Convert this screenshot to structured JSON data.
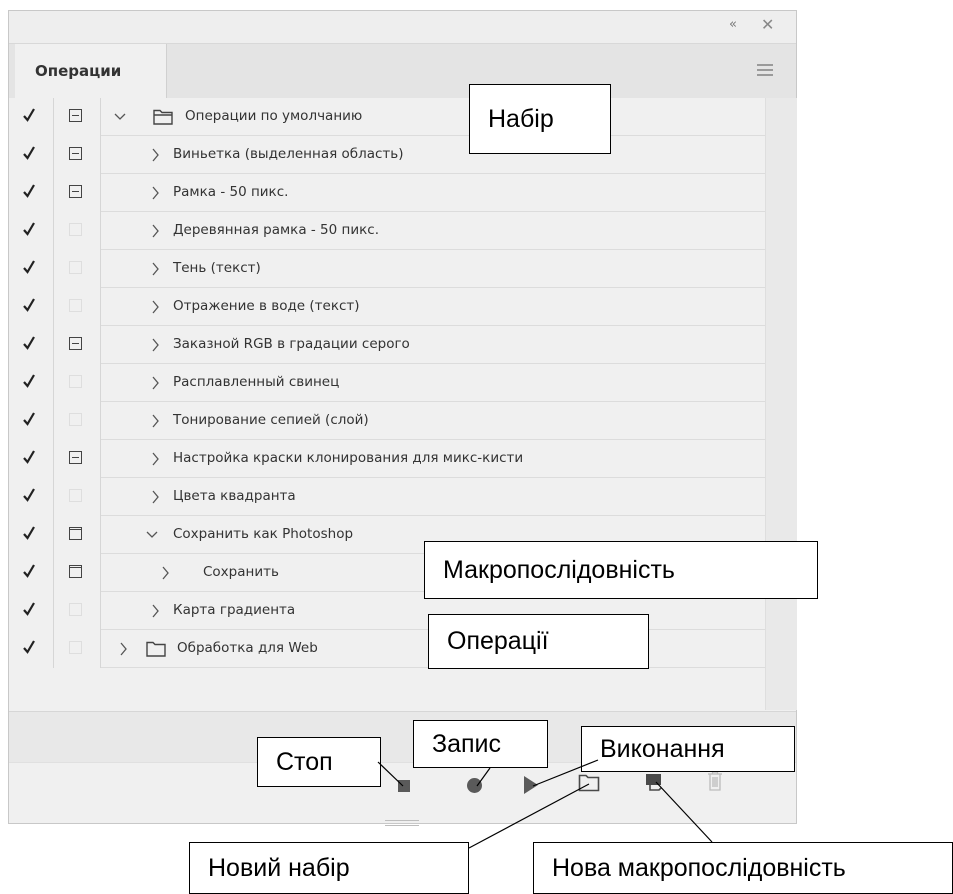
{
  "panel": {
    "tab_label": "Операции",
    "collapse_icon": "«",
    "close_icon": "✕",
    "menu_icon": "hamburger-menu-icon"
  },
  "rows": [
    {
      "label": "Операции по умолчанию",
      "checked": true,
      "dialog": "on",
      "kind": "set",
      "expanded": true
    },
    {
      "label": "Виньетка (выделенная область)",
      "checked": true,
      "dialog": "on",
      "kind": "action",
      "expanded": false
    },
    {
      "label": "Рамка - 50 пикс.",
      "checked": true,
      "dialog": "on",
      "kind": "action",
      "expanded": false
    },
    {
      "label": "Деревянная рамка - 50 пикс.",
      "checked": true,
      "dialog": "off",
      "kind": "action",
      "expanded": false
    },
    {
      "label": "Тень (текст)",
      "checked": true,
      "dialog": "off",
      "kind": "action",
      "expanded": false
    },
    {
      "label": "Отражение в воде (текст)",
      "checked": true,
      "dialog": "off",
      "kind": "action",
      "expanded": false
    },
    {
      "label": "Заказной RGB в градации серого",
      "checked": true,
      "dialog": "on",
      "kind": "action",
      "expanded": false
    },
    {
      "label": "Расплавленный свинец",
      "checked": true,
      "dialog": "off",
      "kind": "action",
      "expanded": false
    },
    {
      "label": "Тонирование сепией (слой)",
      "checked": true,
      "dialog": "off",
      "kind": "action",
      "expanded": false
    },
    {
      "label": "Настройка краски клонирования для микс-кисти",
      "checked": true,
      "dialog": "on",
      "kind": "action",
      "expanded": false
    },
    {
      "label": "Цвета квадранта",
      "checked": true,
      "dialog": "off",
      "kind": "action",
      "expanded": false
    },
    {
      "label": "Сохранить как Photoshop",
      "checked": true,
      "dialog": "empty",
      "kind": "action",
      "expanded": true
    },
    {
      "label": "Сохранить",
      "checked": true,
      "dialog": "empty",
      "kind": "command",
      "expanded": false
    },
    {
      "label": "Карта градиента",
      "checked": true,
      "dialog": "off",
      "kind": "action",
      "expanded": false
    },
    {
      "label": "Обработка для Web",
      "checked": true,
      "dialog": "off",
      "kind": "set",
      "expanded": false
    }
  ],
  "toolbar": {
    "stop": "stop-icon",
    "record": "record-icon",
    "play": "play-icon",
    "new_set": "new-set-folder-icon",
    "new_action": "new-action-icon",
    "delete": "trash-icon"
  },
  "callouts": {
    "set": "Набір",
    "action": "Макропослідовність",
    "operations": "Операції",
    "stop": "Стоп",
    "record": "Запис",
    "play": "Виконання",
    "new_set": "Новий набір",
    "new_action": "Нова макропослідовність"
  }
}
